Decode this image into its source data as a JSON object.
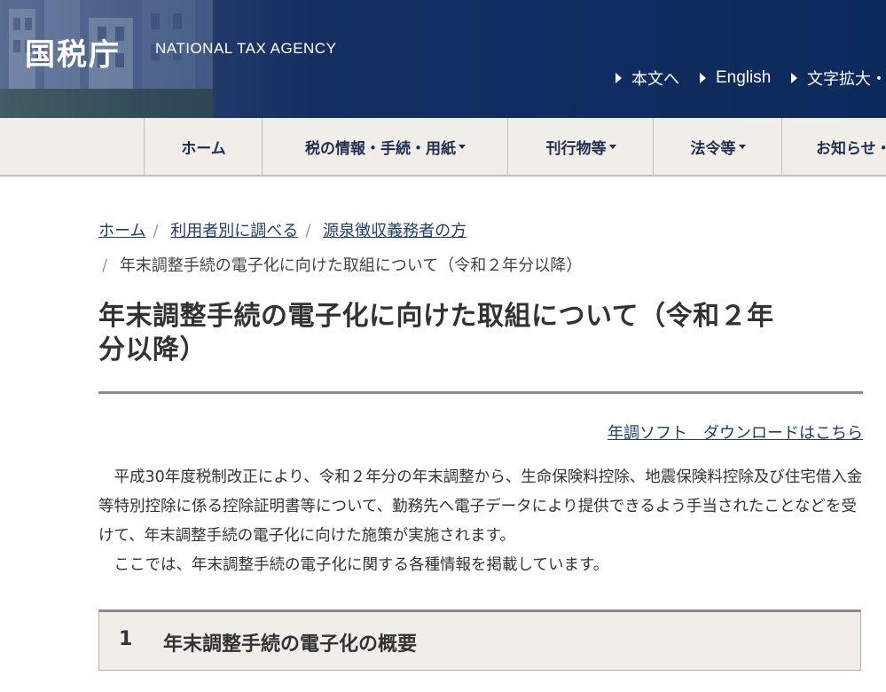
{
  "header": {
    "logo_jp": "国税庁",
    "logo_en": "NATIONAL TAX AGENCY",
    "util_links": [
      "本文へ",
      "English",
      "文字拡大・"
    ]
  },
  "nav": {
    "items": [
      {
        "label": "ホーム",
        "dropdown": false
      },
      {
        "label": "税の情報・手続・用紙",
        "dropdown": true
      },
      {
        "label": "刊行物等",
        "dropdown": true
      },
      {
        "label": "法令等",
        "dropdown": true
      },
      {
        "label": "お知らせ・",
        "dropdown": false
      }
    ]
  },
  "breadcrumb": {
    "items": [
      "ホーム",
      "利用者別に調べる",
      "源泉徴収義務者の方"
    ],
    "current": "年末調整手続の電子化に向けた取組について（令和２年分以降）"
  },
  "page": {
    "title_line1": "年末調整手続の電子化に向けた取組について（令和２年",
    "title_line2": "分以降）",
    "download_link": "年調ソフト　ダウンロードはこちら",
    "paragraphs": [
      "平成30年度税制改正により、令和２年分の年末調整から、生命保険料控除、地震保険料控除及び住宅借入金等特別控除に係る控除証明書等について、勤務先へ電子データにより提供できるよう手当されたことなどを受けて、年末調整手続の電子化に向けた施策が実施されます。",
      "ここでは、年末調整手続の電子化に関する各種情報を掲載しています。"
    ],
    "section": {
      "num": "1",
      "title": "年末調整手続の電子化の概要"
    }
  },
  "colors": {
    "header_bg": "#0d2a5d",
    "nav_bg": "#f1ede8",
    "link": "#1f3d6e",
    "text": "#333333"
  }
}
